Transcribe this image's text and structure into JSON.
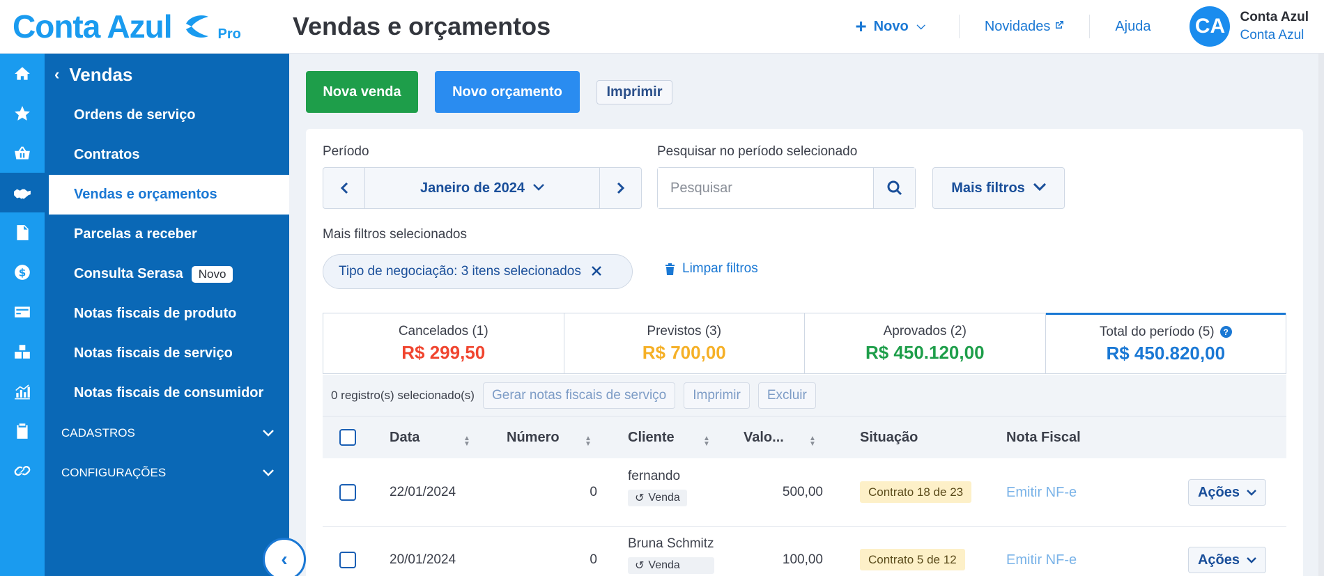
{
  "header": {
    "logo_text": "Conta Azul",
    "logo_badge": "Pro",
    "page_title": "Vendas e orçamentos",
    "novo_label": "Novo",
    "novidades_label": "Novidades",
    "ajuda_label": "Ajuda",
    "user_initials": "CA",
    "user_name": "Conta Azul",
    "user_org": "Conta Azul"
  },
  "rail": {
    "icons": [
      "home-icon",
      "star-icon",
      "basket-icon",
      "handshake-icon",
      "document-icon",
      "dollar-icon",
      "card-icon",
      "boxes-icon",
      "chart-icon",
      "clipboard-icon",
      "link-icon"
    ]
  },
  "nav": {
    "title": "Vendas",
    "items": [
      {
        "label": "Ordens de serviço"
      },
      {
        "label": "Contratos"
      },
      {
        "label": "Vendas e orçamentos"
      },
      {
        "label": "Parcelas a receber"
      },
      {
        "label": "Consulta Serasa",
        "badge": "Novo"
      },
      {
        "label": "Notas fiscais de produto"
      },
      {
        "label": "Notas fiscais de serviço"
      },
      {
        "label": "Notas fiscais de consumidor"
      }
    ],
    "groups": [
      {
        "label": "CADASTROS"
      },
      {
        "label": "CONFIGURAÇÕES"
      }
    ]
  },
  "toolbar": {
    "nova_venda": "Nova venda",
    "novo_orcamento": "Novo orçamento",
    "imprimir": "Imprimir"
  },
  "filters": {
    "periodo_label": "Período",
    "periodo_value": "Janeiro de 2024",
    "search_label": "Pesquisar no período selecionado",
    "search_placeholder": "Pesquisar",
    "mais_filtros": "Mais filtros",
    "selected_label": "Mais filtros selecionados",
    "chip": "Tipo de negociação: 3 itens selecionados",
    "limpar": "Limpar filtros"
  },
  "totals": [
    {
      "title": "Cancelados (1)",
      "value": "R$ 299,50",
      "color": "#f0452f"
    },
    {
      "title": "Previstos (3)",
      "value": "R$ 700,00",
      "color": "#f5b027"
    },
    {
      "title": "Aprovados (2)",
      "value": "R$ 450.120,00",
      "color": "#1e9e4a"
    },
    {
      "title": "Total do período (5)",
      "value": "R$ 450.820,00",
      "color": "#1a78d4"
    }
  ],
  "bulk": {
    "count": "0 registro(s) selecionado(s)",
    "gerar": "Gerar notas fiscais de serviço",
    "imprimir": "Imprimir",
    "excluir": "Excluir"
  },
  "table": {
    "headers": {
      "data": "Data",
      "numero": "Número",
      "cliente": "Cliente",
      "valor": "Valo...",
      "situacao": "Situação",
      "nota": "Nota Fiscal"
    },
    "rows": [
      {
        "data": "22/01/2024",
        "numero": "0",
        "cliente": "fernando",
        "tipo": "Venda",
        "valor": "500,00",
        "situacao": "Contrato 18 de 23",
        "nota": "Emitir NF-e",
        "acoes": "Ações"
      },
      {
        "data": "20/01/2024",
        "numero": "0",
        "cliente": "Bruna Schmitz",
        "tipo": "Venda",
        "valor": "100,00",
        "situacao": "Contrato 5 de 12",
        "nota": "Emitir NF-e",
        "acoes": "Ações"
      }
    ]
  }
}
